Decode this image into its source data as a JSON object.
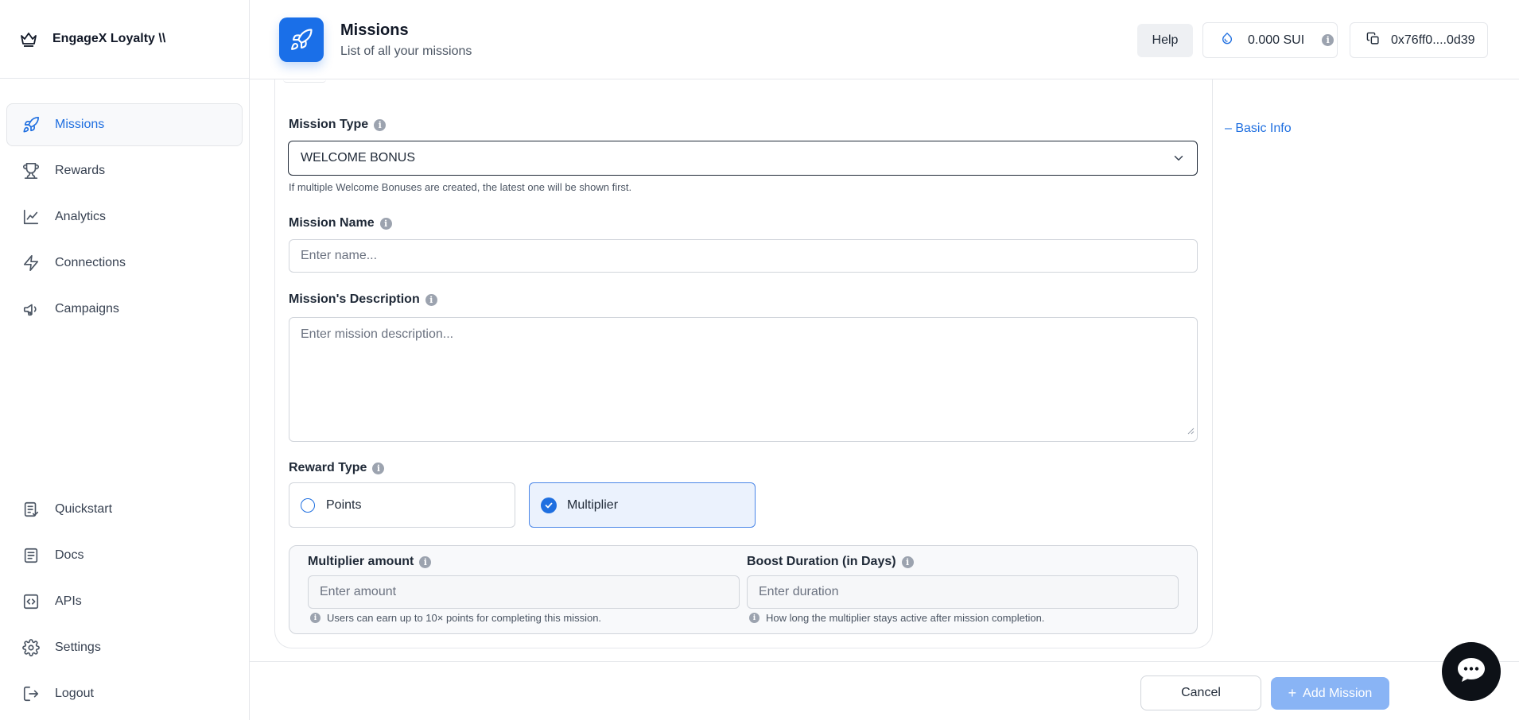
{
  "brand": {
    "name": "EngageX Loyalty \\\\"
  },
  "sidebar": {
    "top_items": [
      {
        "label": "Missions",
        "icon": "rocket-icon",
        "active": true
      },
      {
        "label": "Rewards",
        "icon": "trophy-icon"
      },
      {
        "label": "Analytics",
        "icon": "chart-line-icon"
      },
      {
        "label": "Connections",
        "icon": "bolt-icon"
      },
      {
        "label": "Campaigns",
        "icon": "megaphone-icon"
      }
    ],
    "bottom_items": [
      {
        "label": "Quickstart",
        "icon": "clipboard-icon"
      },
      {
        "label": "Docs",
        "icon": "document-icon"
      },
      {
        "label": "APIs",
        "icon": "code-icon"
      },
      {
        "label": "Settings",
        "icon": "gear-icon"
      },
      {
        "label": "Logout",
        "icon": "logout-icon"
      }
    ]
  },
  "header": {
    "title": "Missions",
    "subtitle": "List of all your missions",
    "help_label": "Help",
    "balance": "0.000 SUI",
    "wallet": "0x76ff0....0d39"
  },
  "form": {
    "mission_type": {
      "label": "Mission Type",
      "value": "WELCOME BONUS",
      "hint": "If multiple Welcome Bonuses are created, the latest one will be shown first."
    },
    "mission_name": {
      "label": "Mission Name",
      "placeholder": "Enter name..."
    },
    "description": {
      "label": "Mission's Description",
      "placeholder": "Enter mission description..."
    },
    "reward_type": {
      "label": "Reward Type",
      "options": [
        "Points",
        "Multiplier"
      ],
      "selected": "Multiplier"
    },
    "multiplier_amount": {
      "label": "Multiplier amount",
      "placeholder": "Enter amount",
      "hint": "Users can earn up to 10× points for completing this mission."
    },
    "boost_duration": {
      "label": "Boost Duration (in Days)",
      "placeholder": "Enter duration",
      "hint": "How long the multiplier stays active after mission completion."
    }
  },
  "side_nav": {
    "basic_info": "– Basic Info"
  },
  "footer": {
    "cancel_label": "Cancel",
    "add_label": "Add Mission"
  },
  "colors": {
    "accent": "#1f6fe0",
    "selected_bg": "#ebf2fd",
    "add_button": "#89b4f5"
  }
}
